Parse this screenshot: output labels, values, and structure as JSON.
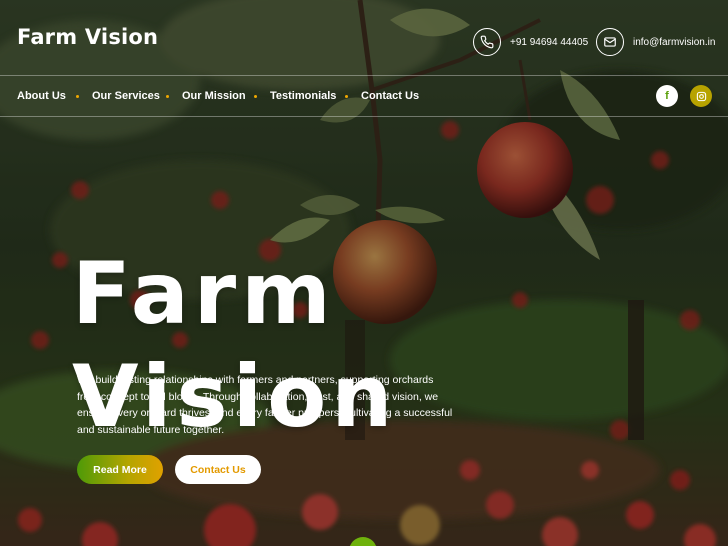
{
  "header": {
    "logo": "Farm Vision",
    "phone": "+91 94694 44405",
    "email": "info@farmvision.in",
    "phone_icon": "phone-icon",
    "email_icon": "mail-icon"
  },
  "nav": {
    "items": [
      {
        "label": "About Us"
      },
      {
        "label": "Our Services"
      },
      {
        "label": "Our Mission"
      },
      {
        "label": "Testimonials"
      },
      {
        "label": "Contact Us"
      }
    ],
    "dot_color": "#f0a800"
  },
  "social": {
    "facebook": {
      "icon": "facebook-icon",
      "glyph": "f"
    },
    "instagram": {
      "icon": "instagram-icon"
    }
  },
  "hero": {
    "title": "Farm Vision",
    "description": "We build lasting relationships with farmers and partners, supporting orchards from concept to full bloom. Through collaboration, trust, and shared vision, we ensure every orchard thrives, and every farmer prospers, cultivating a successful and sustainable future together.",
    "primary_button": "Read More",
    "secondary_button": "Contact Us"
  },
  "colors": {
    "accent_green": "#4e9a08",
    "accent_gold": "#e0a100",
    "secondary_text": "#e39a00"
  }
}
